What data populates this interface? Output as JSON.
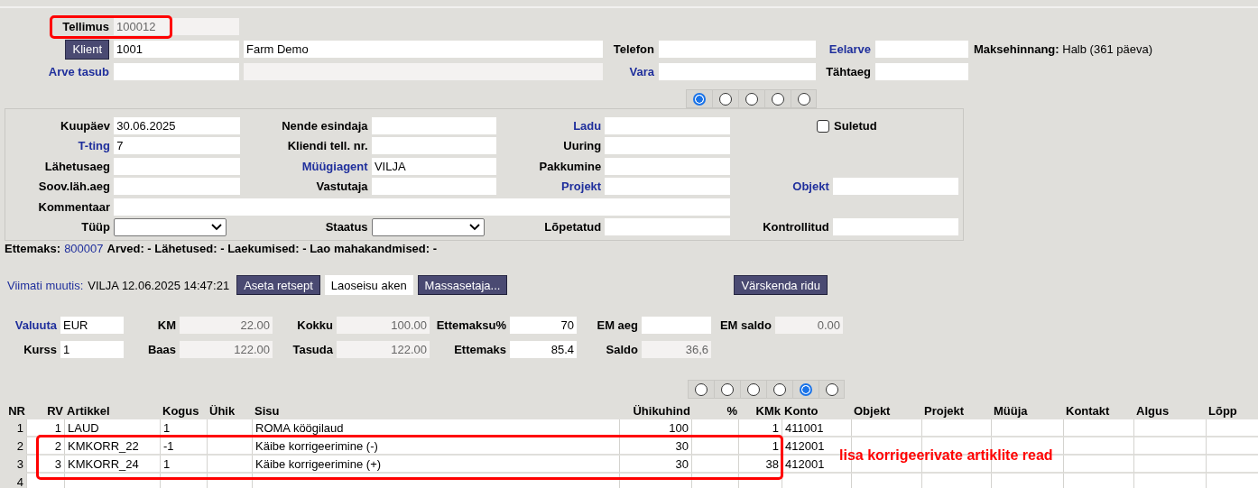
{
  "header": {
    "rows": [
      {
        "highlighted": true,
        "items": [
          {
            "kind": "label",
            "text": "Tellimus"
          },
          {
            "kind": "field",
            "value": "100012",
            "readonly": true,
            "muted": true
          }
        ]
      },
      {
        "highlighted": false,
        "items": [
          {
            "kind": "button",
            "text": "Klient"
          },
          {
            "kind": "field",
            "value": "1001"
          },
          {
            "kind": "field",
            "value": "Farm Demo"
          },
          {
            "kind": "label",
            "text": "Telefon"
          },
          {
            "kind": "field"
          },
          {
            "kind": "label",
            "text": "Eelarve",
            "link": true
          },
          {
            "kind": "field"
          },
          {
            "kind": "info",
            "label": "Maksehinnang:",
            "value": "Halb (361 päeva)"
          }
        ]
      },
      {
        "highlighted": false,
        "items": [
          {
            "kind": "label",
            "text": "Arve tasub",
            "link": true
          },
          {
            "kind": "field"
          },
          {
            "kind": "field",
            "readonly": true
          },
          {
            "kind": "label",
            "text": "Vara",
            "link": true
          },
          {
            "kind": "field"
          },
          {
            "kind": "label",
            "text": "Tähtaeg"
          },
          {
            "kind": "field"
          }
        ]
      }
    ]
  },
  "header_tabs": [
    {
      "selected": true
    },
    {
      "selected": false
    },
    {
      "selected": false
    },
    {
      "selected": false
    },
    {
      "selected": false
    }
  ],
  "details": {
    "rows": [
      [
        {
          "kind": "field",
          "label": "Kuupäev",
          "value": "30.06.2025"
        },
        {
          "kind": "field",
          "label": "Nende esindaja"
        },
        {
          "kind": "field",
          "label": "Ladu",
          "link": true
        },
        {
          "kind": "checkbox",
          "label": "Suletud",
          "checked": false
        }
      ],
      [
        {
          "kind": "field",
          "label": "T-ting",
          "link": true,
          "value": "7"
        },
        {
          "kind": "field",
          "label": "Kliendi tell. nr."
        },
        {
          "kind": "field",
          "label": "Uuring"
        },
        null
      ],
      [
        {
          "kind": "field",
          "label": "Lähetusaeg"
        },
        {
          "kind": "field",
          "label": "Müügiagent",
          "link": true,
          "value": "VILJA"
        },
        {
          "kind": "field",
          "label": "Pakkumine"
        },
        null
      ],
      [
        {
          "kind": "field",
          "label": "Soov.läh.aeg"
        },
        {
          "kind": "field",
          "label": "Vastutaja"
        },
        {
          "kind": "field",
          "label": "Projekt",
          "link": true
        },
        {
          "kind": "field",
          "label": "Objekt",
          "link": true
        }
      ],
      [
        {
          "kind": "wide",
          "label": "Kommentaar"
        }
      ],
      [
        {
          "kind": "select",
          "label": "Tüüp"
        },
        {
          "kind": "select",
          "label": "Staatus"
        },
        {
          "kind": "field",
          "label": "Lõpetatud"
        },
        {
          "kind": "field",
          "label": "Kontrollitud"
        }
      ]
    ]
  },
  "summary_line": {
    "label": "Ettemaks:",
    "link": "800007",
    "rest": "Arved: - Lähetused: - Laekumised: - Lao mahakandmised: -"
  },
  "toolbar": {
    "modified_label": "Viimati muutis:",
    "modified_value": "VILJA 12.06.2025 14:47:21",
    "buttons": [
      {
        "text": "Aseta retsept",
        "kind": "dark"
      },
      {
        "text": "Laoseisu aken",
        "kind": "light"
      },
      {
        "text": "Massasetaja...",
        "kind": "dark"
      }
    ],
    "refresh_button": "Värskenda ridu"
  },
  "totals": {
    "rows": [
      [
        {
          "label": "Valuuta",
          "link": true,
          "value": "EUR",
          "kind": "text"
        },
        {
          "label": "KM",
          "value": "22.00",
          "readonly": true,
          "kind": "number"
        },
        {
          "label": "Kokku",
          "value": "100.00",
          "readonly": true,
          "kind": "number"
        },
        {
          "label": "Ettemaksu%",
          "value": "70",
          "kind": "number"
        },
        {
          "label": "EM aeg",
          "kind": "text"
        },
        {
          "label": "EM saldo",
          "value": "0.00",
          "readonly": true,
          "kind": "number"
        }
      ],
      [
        {
          "label": "Kurss",
          "value": "1",
          "kind": "text"
        },
        {
          "label": "Baas",
          "value": "122.00",
          "readonly": true,
          "kind": "number"
        },
        {
          "label": "Tasuda",
          "value": "122.00",
          "readonly": true,
          "kind": "number"
        },
        {
          "label": "Ettemaks",
          "value": "85.4",
          "kind": "number"
        },
        {
          "label": "Saldo",
          "value": "36,6",
          "readonly": true,
          "kind": "number"
        }
      ]
    ]
  },
  "row_tabs": [
    {
      "selected": false
    },
    {
      "selected": false
    },
    {
      "selected": false
    },
    {
      "selected": false
    },
    {
      "selected": true
    },
    {
      "selected": false
    }
  ],
  "table": {
    "columns": [
      {
        "label": "NR",
        "kind": "number"
      },
      {
        "label": "RV",
        "kind": "number"
      },
      {
        "label": "Artikkel",
        "kind": "text"
      },
      {
        "label": "Kogus",
        "kind": "text"
      },
      {
        "label": "Ühik",
        "kind": "text"
      },
      {
        "label": "Sisu",
        "kind": "text"
      },
      {
        "label": "Ühikuhind",
        "kind": "number"
      },
      {
        "label": "%",
        "kind": "number"
      },
      {
        "label": "KMk",
        "kind": "number"
      },
      {
        "label": "Konto",
        "kind": "text"
      },
      {
        "label": "Objekt",
        "kind": "text"
      },
      {
        "label": "Projekt",
        "kind": "text"
      },
      {
        "label": "Müüja",
        "kind": "text"
      },
      {
        "label": "Kontakt",
        "kind": "text"
      },
      {
        "label": "Algus",
        "kind": "text"
      },
      {
        "label": "Lõpp",
        "kind": "text"
      }
    ],
    "rows": [
      {
        "highlighted": false,
        "cells": [
          "1",
          "1",
          "LAUD",
          "1",
          null,
          "ROMA köögilaud",
          "100",
          null,
          "1",
          "411001",
          null,
          null,
          null,
          null,
          null,
          null
        ]
      },
      {
        "highlighted": true,
        "cells": [
          "2",
          "2",
          "KMKORR_22",
          "-1",
          null,
          "Käibe korrigeerimine (-)",
          "30",
          null,
          "1",
          "412001",
          null,
          null,
          null,
          null,
          null,
          null
        ]
      },
      {
        "highlighted": true,
        "cells": [
          "3",
          "3",
          "KMKORR_24",
          "1",
          null,
          "Käibe korrigeerimine (+)",
          "30",
          null,
          "38",
          "412001",
          null,
          null,
          null,
          null,
          null,
          null
        ]
      },
      {
        "highlighted": false,
        "cells": [
          "4",
          null,
          null,
          null,
          null,
          null,
          null,
          null,
          null,
          null,
          null,
          null,
          null,
          null,
          null,
          null
        ]
      }
    ],
    "annotation": "lisa korrigeerivate artiklite read"
  }
}
